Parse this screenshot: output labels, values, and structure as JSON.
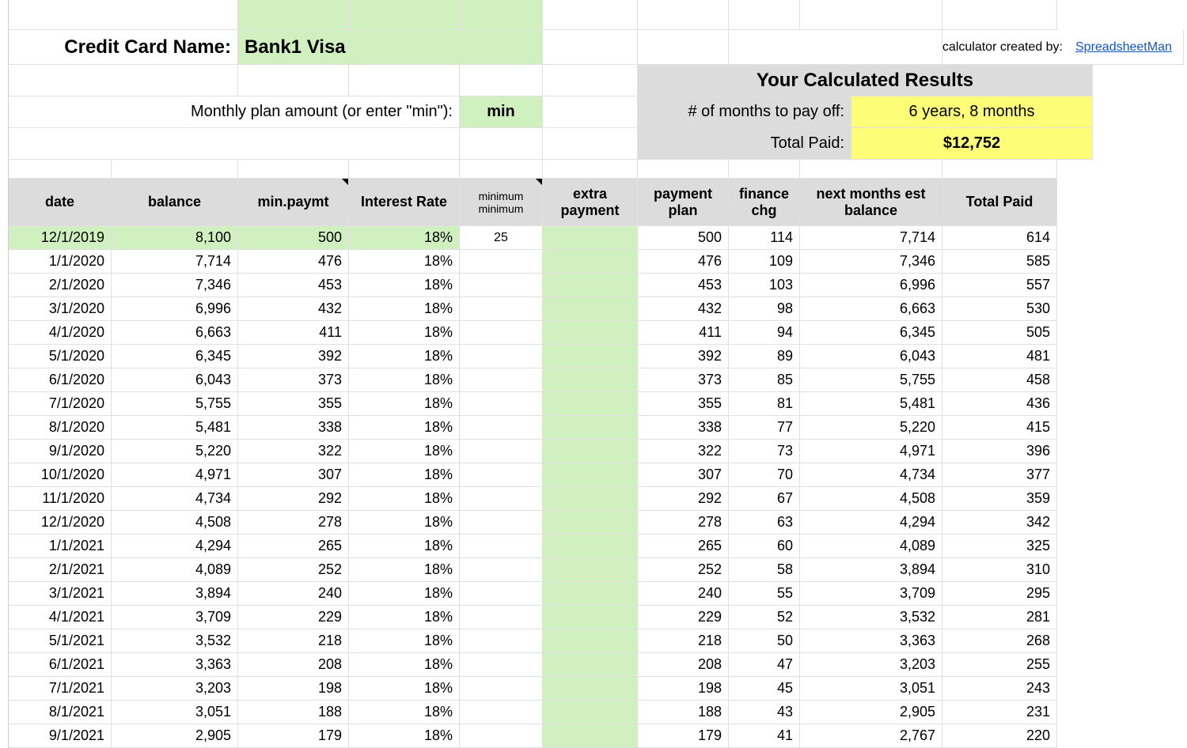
{
  "header": {
    "credit_card_name_label": "Credit Card Name:",
    "credit_card_name_value": "Bank1 Visa",
    "calculator_created_by_label": "calculator created by:",
    "calculator_created_by_link": "SpreadsheetMan",
    "monthly_plan_label": "Monthly plan amount (or enter \"min\"):",
    "monthly_plan_value": "min",
    "results_title": "Your Calculated Results",
    "months_label": "# of months to pay off:",
    "months_value": "6 years, 8 months",
    "total_paid_label": "Total Paid:",
    "total_paid_value": "$12,752"
  },
  "columns": {
    "date": "date",
    "balance": "balance",
    "min_paymt": "min.paymt",
    "interest_rate": "Interest Rate",
    "minimum_minimum": "minimum minimum",
    "extra_payment": "extra payment",
    "payment_plan": "payment plan",
    "finance_chg": "finance chg",
    "next_bal": "next months est balance",
    "total_paid": "Total Paid"
  },
  "minimum_minimum_value": "25",
  "rows": [
    {
      "date": "12/1/2019",
      "balance": "8,100",
      "min_paymt": "500",
      "int_rate": "18%",
      "extra": "",
      "plan": "500",
      "fin": "114",
      "next": "7,714",
      "tot": "614"
    },
    {
      "date": "1/1/2020",
      "balance": "7,714",
      "min_paymt": "476",
      "int_rate": "18%",
      "extra": "",
      "plan": "476",
      "fin": "109",
      "next": "7,346",
      "tot": "585"
    },
    {
      "date": "2/1/2020",
      "balance": "7,346",
      "min_paymt": "453",
      "int_rate": "18%",
      "extra": "",
      "plan": "453",
      "fin": "103",
      "next": "6,996",
      "tot": "557"
    },
    {
      "date": "3/1/2020",
      "balance": "6,996",
      "min_paymt": "432",
      "int_rate": "18%",
      "extra": "",
      "plan": "432",
      "fin": "98",
      "next": "6,663",
      "tot": "530"
    },
    {
      "date": "4/1/2020",
      "balance": "6,663",
      "min_paymt": "411",
      "int_rate": "18%",
      "extra": "",
      "plan": "411",
      "fin": "94",
      "next": "6,345",
      "tot": "505"
    },
    {
      "date": "5/1/2020",
      "balance": "6,345",
      "min_paymt": "392",
      "int_rate": "18%",
      "extra": "",
      "plan": "392",
      "fin": "89",
      "next": "6,043",
      "tot": "481"
    },
    {
      "date": "6/1/2020",
      "balance": "6,043",
      "min_paymt": "373",
      "int_rate": "18%",
      "extra": "",
      "plan": "373",
      "fin": "85",
      "next": "5,755",
      "tot": "458"
    },
    {
      "date": "7/1/2020",
      "balance": "5,755",
      "min_paymt": "355",
      "int_rate": "18%",
      "extra": "",
      "plan": "355",
      "fin": "81",
      "next": "5,481",
      "tot": "436"
    },
    {
      "date": "8/1/2020",
      "balance": "5,481",
      "min_paymt": "338",
      "int_rate": "18%",
      "extra": "",
      "plan": "338",
      "fin": "77",
      "next": "5,220",
      "tot": "415"
    },
    {
      "date": "9/1/2020",
      "balance": "5,220",
      "min_paymt": "322",
      "int_rate": "18%",
      "extra": "",
      "plan": "322",
      "fin": "73",
      "next": "4,971",
      "tot": "396"
    },
    {
      "date": "10/1/2020",
      "balance": "4,971",
      "min_paymt": "307",
      "int_rate": "18%",
      "extra": "",
      "plan": "307",
      "fin": "70",
      "next": "4,734",
      "tot": "377"
    },
    {
      "date": "11/1/2020",
      "balance": "4,734",
      "min_paymt": "292",
      "int_rate": "18%",
      "extra": "",
      "plan": "292",
      "fin": "67",
      "next": "4,508",
      "tot": "359"
    },
    {
      "date": "12/1/2020",
      "balance": "4,508",
      "min_paymt": "278",
      "int_rate": "18%",
      "extra": "",
      "plan": "278",
      "fin": "63",
      "next": "4,294",
      "tot": "342"
    },
    {
      "date": "1/1/2021",
      "balance": "4,294",
      "min_paymt": "265",
      "int_rate": "18%",
      "extra": "",
      "plan": "265",
      "fin": "60",
      "next": "4,089",
      "tot": "325"
    },
    {
      "date": "2/1/2021",
      "balance": "4,089",
      "min_paymt": "252",
      "int_rate": "18%",
      "extra": "",
      "plan": "252",
      "fin": "58",
      "next": "3,894",
      "tot": "310"
    },
    {
      "date": "3/1/2021",
      "balance": "3,894",
      "min_paymt": "240",
      "int_rate": "18%",
      "extra": "",
      "plan": "240",
      "fin": "55",
      "next": "3,709",
      "tot": "295"
    },
    {
      "date": "4/1/2021",
      "balance": "3,709",
      "min_paymt": "229",
      "int_rate": "18%",
      "extra": "",
      "plan": "229",
      "fin": "52",
      "next": "3,532",
      "tot": "281"
    },
    {
      "date": "5/1/2021",
      "balance": "3,532",
      "min_paymt": "218",
      "int_rate": "18%",
      "extra": "",
      "plan": "218",
      "fin": "50",
      "next": "3,363",
      "tot": "268"
    },
    {
      "date": "6/1/2021",
      "balance": "3,363",
      "min_paymt": "208",
      "int_rate": "18%",
      "extra": "",
      "plan": "208",
      "fin": "47",
      "next": "3,203",
      "tot": "255"
    },
    {
      "date": "7/1/2021",
      "balance": "3,203",
      "min_paymt": "198",
      "int_rate": "18%",
      "extra": "",
      "plan": "198",
      "fin": "45",
      "next": "3,051",
      "tot": "243"
    },
    {
      "date": "8/1/2021",
      "balance": "3,051",
      "min_paymt": "188",
      "int_rate": "18%",
      "extra": "",
      "plan": "188",
      "fin": "43",
      "next": "2,905",
      "tot": "231"
    },
    {
      "date": "9/1/2021",
      "balance": "2,905",
      "min_paymt": "179",
      "int_rate": "18%",
      "extra": "",
      "plan": "179",
      "fin": "41",
      "next": "2,767",
      "tot": "220"
    }
  ]
}
